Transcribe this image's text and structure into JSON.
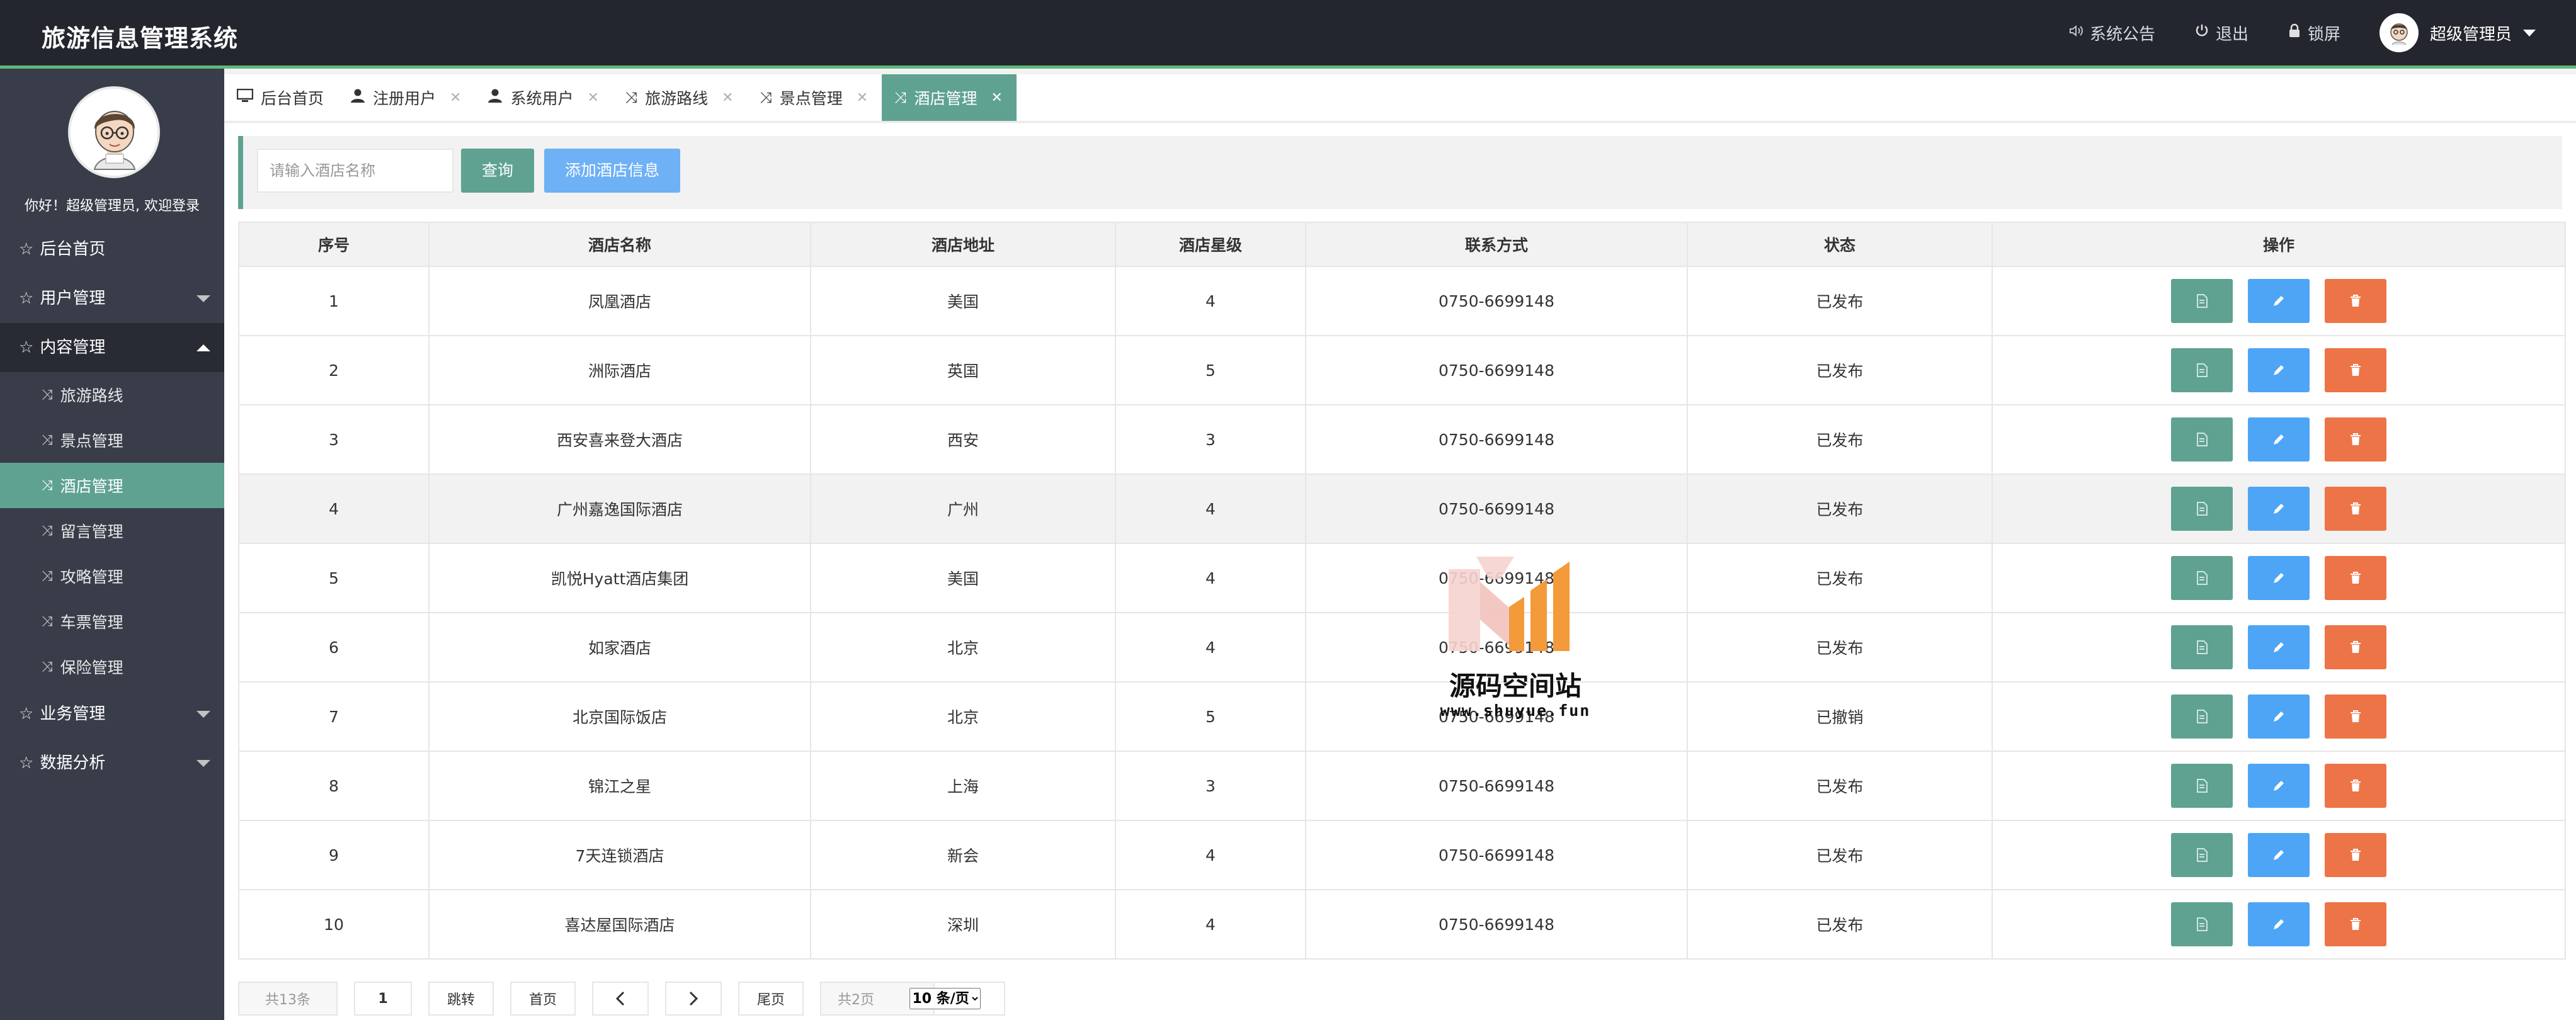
{
  "app": {
    "title": "旅游信息管理系统"
  },
  "header": {
    "announcement": "系统公告",
    "logout": "退出",
    "lock": "锁屏",
    "user": "超级管理员"
  },
  "sidebar": {
    "welcome": "你好！超级管理员, 欢迎登录",
    "menu": {
      "home": "后台首页",
      "users": "用户管理",
      "content": "内容管理",
      "content_sub": [
        "旅游路线",
        "景点管理",
        "酒店管理",
        "留言管理",
        "攻略管理",
        "车票管理",
        "保险管理"
      ],
      "business": "业务管理",
      "analytics": "数据分析"
    }
  },
  "tabs": [
    {
      "label": "后台首页",
      "closable": false
    },
    {
      "label": "注册用户",
      "closable": true
    },
    {
      "label": "系统用户",
      "closable": true
    },
    {
      "label": "旅游路线",
      "closable": true
    },
    {
      "label": "景点管理",
      "closable": true
    },
    {
      "label": "酒店管理",
      "closable": true
    }
  ],
  "tab_close_glyph": "✕",
  "toolbar": {
    "search_placeholder": "请输入酒店名称",
    "search_value": "",
    "query_label": "查询",
    "add_label": "添加酒店信息"
  },
  "table": {
    "headers": [
      "序号",
      "酒店名称",
      "酒店地址",
      "酒店星级",
      "联系方式",
      "状态",
      "操作"
    ],
    "rows": [
      [
        "1",
        "凤凰酒店",
        "美国",
        "4",
        "0750-6699148",
        "已发布"
      ],
      [
        "2",
        "洲际酒店",
        "英国",
        "5",
        "0750-6699148",
        "已发布"
      ],
      [
        "3",
        "西安喜来登大酒店",
        "西安",
        "3",
        "0750-6699148",
        "已发布"
      ],
      [
        "4",
        "广州嘉逸国际酒店",
        "广州",
        "4",
        "0750-6699148",
        "已发布"
      ],
      [
        "5",
        "凯悦Hyatt酒店集团",
        "美国",
        "4",
        "0750-6699148",
        "已发布"
      ],
      [
        "6",
        "如家酒店",
        "北京",
        "4",
        "0750-6699148",
        "已发布"
      ],
      [
        "7",
        "北京国际饭店",
        "北京",
        "5",
        "0750-6699148",
        "已撤销"
      ],
      [
        "8",
        "锦江之星",
        "上海",
        "3",
        "0750-6699148",
        "已发布"
      ],
      [
        "9",
        "7天连锁酒店",
        "新会",
        "4",
        "0750-6699148",
        "已发布"
      ],
      [
        "10",
        "喜达屋国际酒店",
        "深圳",
        "4",
        "0750-6699148",
        "已发布"
      ]
    ]
  },
  "pager": {
    "total": "共13条",
    "current_page": "1",
    "jump": "跳转",
    "first": "首页",
    "last": "尾页",
    "pages": "共2页",
    "page_size": "10 条/页"
  },
  "watermark": {
    "text": "源码空间站",
    "url": "www.shuyue.fun"
  },
  "colors": {
    "accent": "#5fa292",
    "header_bg": "#23262e",
    "sidebar_bg": "#393d49",
    "view": "#5fa292",
    "edit": "#4ea5f6",
    "delete": "#ed7447"
  }
}
